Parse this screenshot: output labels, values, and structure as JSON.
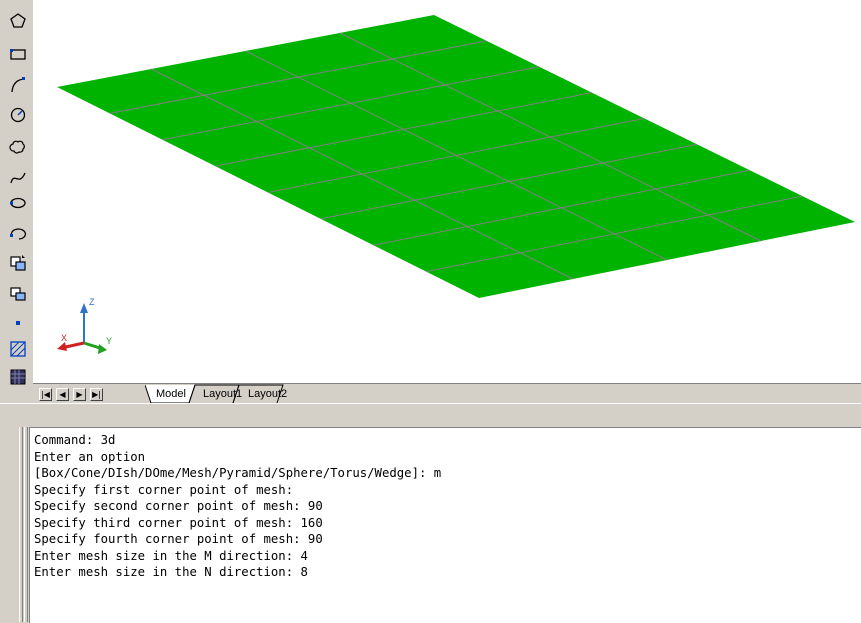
{
  "toolbar": {
    "tools": [
      "polygon-icon",
      "rectangle-icon",
      "arc-icon",
      "circle-icon",
      "revision-cloud-icon",
      "spline-icon",
      "ellipse-icon",
      "ellipse-arc-icon",
      "insert-block-icon",
      "make-block-icon",
      "point-icon",
      "hatch-icon",
      "gradient-icon"
    ]
  },
  "viewport": {
    "mesh_color": "#00b300",
    "mesh_line_color": "#808080",
    "mesh": {
      "m_size": 4,
      "n_size": 8
    },
    "ucs": {
      "x_label": "X",
      "y_label": "Y",
      "z_label": "Z"
    }
  },
  "tabs": {
    "nav_first": "|◀",
    "nav_prev": "◀",
    "nav_next": "▶",
    "nav_last": "▶|",
    "items": [
      "Model",
      "Layout1",
      "Layout2"
    ],
    "active": "Model"
  },
  "command_window": {
    "lines": [
      "Command: 3d",
      "Enter an option",
      "[Box/Cone/DIsh/DOme/Mesh/Pyramid/Sphere/Torus/Wedge]: m",
      "Specify first corner point of mesh:",
      "Specify second corner point of mesh: 90",
      "Specify third corner point of mesh: 160",
      "Specify fourth corner point of mesh: 90",
      "Enter mesh size in the M direction: 4",
      "Enter mesh size in the N direction: 8"
    ]
  }
}
